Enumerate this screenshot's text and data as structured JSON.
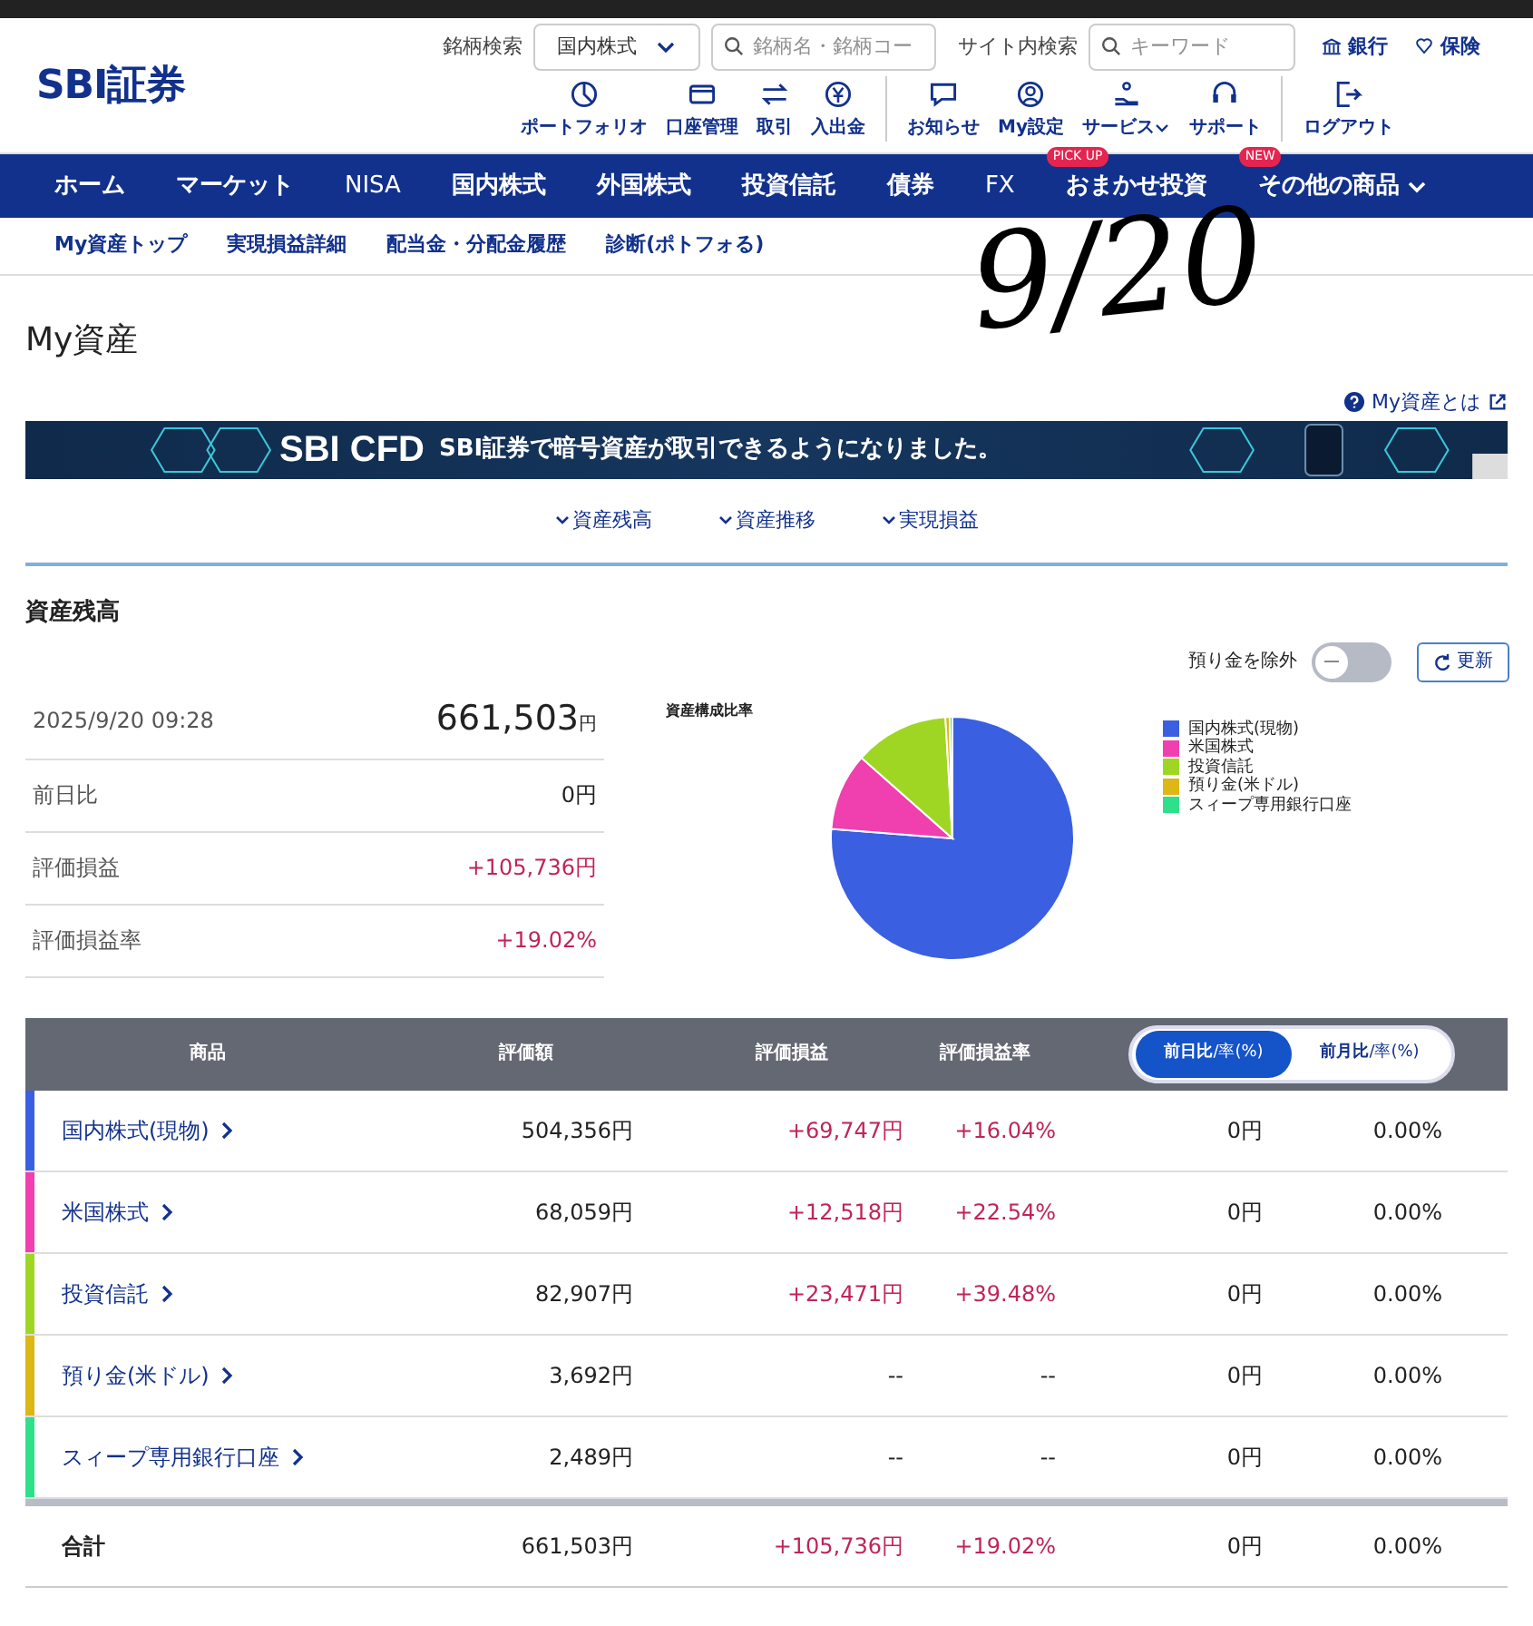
{
  "header": {
    "logo": "SBI証券",
    "search_label": "銘柄検索",
    "market_select": "国内株式",
    "symbol_search": {
      "placeholder": "銘柄名・銘柄コー"
    },
    "site_search_label": "サイト内検索",
    "site_search": {
      "placeholder": "キーワード"
    },
    "top_links": [
      {
        "kind": "bank",
        "label": "銀行"
      },
      {
        "kind": "insurance",
        "label": "保険"
      }
    ],
    "icon_links": [
      {
        "kind": "portfolio",
        "label": "ポートフォリオ"
      },
      {
        "kind": "account",
        "label": "口座管理"
      },
      {
        "kind": "trade",
        "label": "取引"
      },
      {
        "kind": "deposit",
        "label": "入出金"
      },
      {
        "kind": "notice",
        "label": "お知らせ"
      },
      {
        "kind": "mysettings",
        "label": "My設定"
      },
      {
        "kind": "service",
        "label": "サービス"
      },
      {
        "kind": "support",
        "label": "サポート"
      },
      {
        "kind": "logout",
        "label": "ログアウト"
      }
    ]
  },
  "nav": [
    {
      "label": "ホーム"
    },
    {
      "label": "マーケット"
    },
    {
      "label": "NISA"
    },
    {
      "label": "国内株式"
    },
    {
      "label": "外国株式"
    },
    {
      "label": "投資信託"
    },
    {
      "label": "債券"
    },
    {
      "label": "FX"
    },
    {
      "label": "おまかせ投資",
      "badge": "PICK UP"
    },
    {
      "label": "その他の商品",
      "badge": "NEW",
      "dropdown": true
    }
  ],
  "subnav": [
    "My資産トップ",
    "実現損益詳細",
    "配当金・分配金履歴",
    "診断(ポトフォる)"
  ],
  "annotation": "9/20",
  "page_title": "My資産",
  "help_link": "My資産とは",
  "banner": {
    "title": "SBI CFD",
    "text": "SBI証券で暗号資産が取引できるようになりました。"
  },
  "anchors": [
    "資産残高",
    "資産推移",
    "実現損益"
  ],
  "section_title": "資産残高",
  "exclude_deposit": {
    "label": "預り金を除外",
    "on": false
  },
  "refresh": "更新",
  "summary": {
    "datetime": "2025/9/20 09:28",
    "total": "661,503",
    "unit": "円",
    "rows": [
      {
        "label": "前日比",
        "value": "0円",
        "positive": false
      },
      {
        "label": "評価損益",
        "value": "+105,736円",
        "positive": true
      },
      {
        "label": "評価損益率",
        "value": "+19.02%",
        "positive": true
      }
    ]
  },
  "chart": {
    "title": "資産構成比率",
    "legend": [
      {
        "label": "国内株式(現物)",
        "color": "#3a5fe0"
      },
      {
        "label": "米国株式",
        "color": "#f03fae"
      },
      {
        "label": "投資信託",
        "color": "#9fd624"
      },
      {
        "label": "預り金(米ドル)",
        "color": "#dcb716"
      },
      {
        "label": "スィープ専用銀行口座",
        "color": "#2fe08a"
      }
    ]
  },
  "table": {
    "columns": [
      "商品",
      "評価額",
      "評価損益",
      "評価損益率"
    ],
    "period_toggle": [
      {
        "label": "前日比",
        "suffix": "/率(%)",
        "selected": true
      },
      {
        "label": "前月比",
        "suffix": "/率(%)",
        "selected": false
      }
    ],
    "rows": [
      {
        "name": "国内株式(現物)",
        "color": "#3a5fe0",
        "value": "504,356円",
        "pl": "+69,747円",
        "rate": "+16.04%",
        "day": "0円",
        "day_rate": "0.00%"
      },
      {
        "name": "米国株式",
        "color": "#f03fae",
        "value": "68,059円",
        "pl": "+12,518円",
        "rate": "+22.54%",
        "day": "0円",
        "day_rate": "0.00%"
      },
      {
        "name": "投資信託",
        "color": "#9fd624",
        "value": "82,907円",
        "pl": "+23,471円",
        "rate": "+39.48%",
        "day": "0円",
        "day_rate": "0.00%"
      },
      {
        "name": "預り金(米ドル)",
        "color": "#dcb716",
        "value": "3,692円",
        "pl": "--",
        "rate": "--",
        "day": "0円",
        "day_rate": "0.00%"
      },
      {
        "name": "スィープ専用銀行口座",
        "color": "#2fe08a",
        "value": "2,489円",
        "pl": "--",
        "rate": "--",
        "day": "0円",
        "day_rate": "0.00%"
      }
    ],
    "total": {
      "name": "合計",
      "value": "661,503円",
      "pl": "+105,736円",
      "rate": "+19.02%",
      "day": "0円",
      "day_rate": "0.00%"
    }
  }
}
